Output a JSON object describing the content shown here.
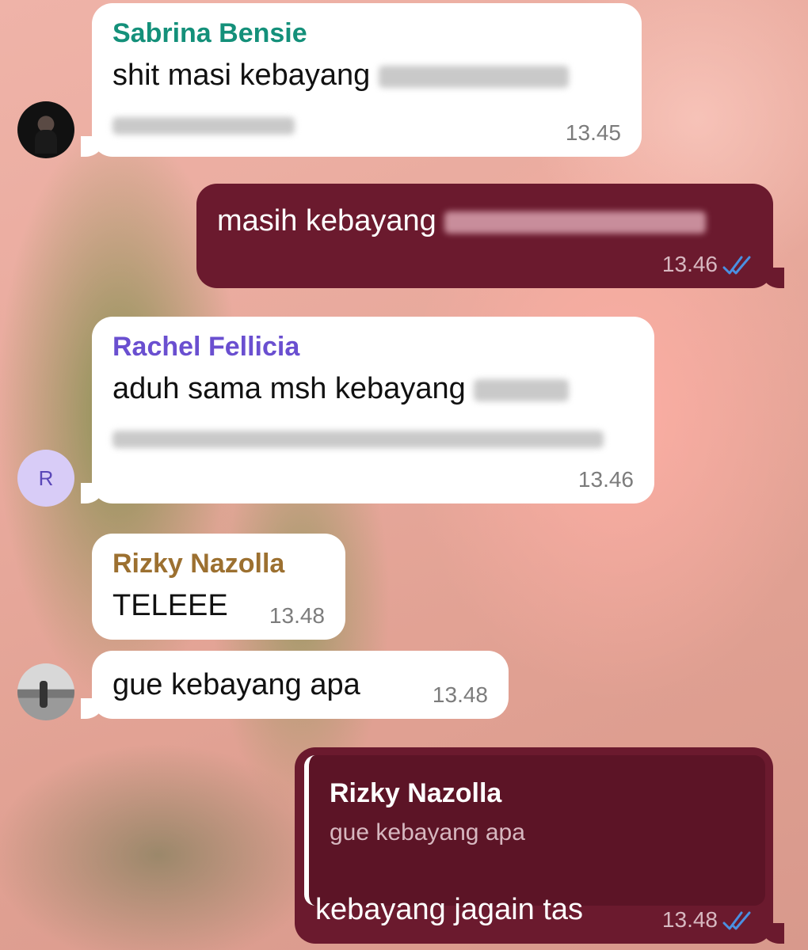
{
  "messages": [
    {
      "sender": "Sabrina Bensie",
      "text": "shit masi kebayang",
      "time": "13.45"
    },
    {
      "text": "masih kebayang",
      "time": "13.46"
    },
    {
      "sender": "Rachel Fellicia",
      "text": "aduh sama msh kebayang",
      "time": "13.46",
      "avatar_letter": "R"
    },
    {
      "sender": "Rizky Nazolla",
      "text": "TELEEE",
      "time": "13.48"
    },
    {
      "text": "gue kebayang apa",
      "time": "13.48"
    },
    {
      "reply": {
        "sender": "Rizky Nazolla",
        "text": "gue kebayang apa"
      },
      "text": "kebayang jagain tas",
      "time": "13.48"
    }
  ],
  "colors": {
    "incoming_bubble": "#ffffff",
    "outgoing_bubble": "#6b1a2e",
    "read_check": "#4a90e2",
    "sabrina_name": "#14907a",
    "rachel_name": "#6a4fd0",
    "rizky_name": "#9c7030"
  },
  "icons": {
    "read_receipt": "double-check-icon"
  }
}
